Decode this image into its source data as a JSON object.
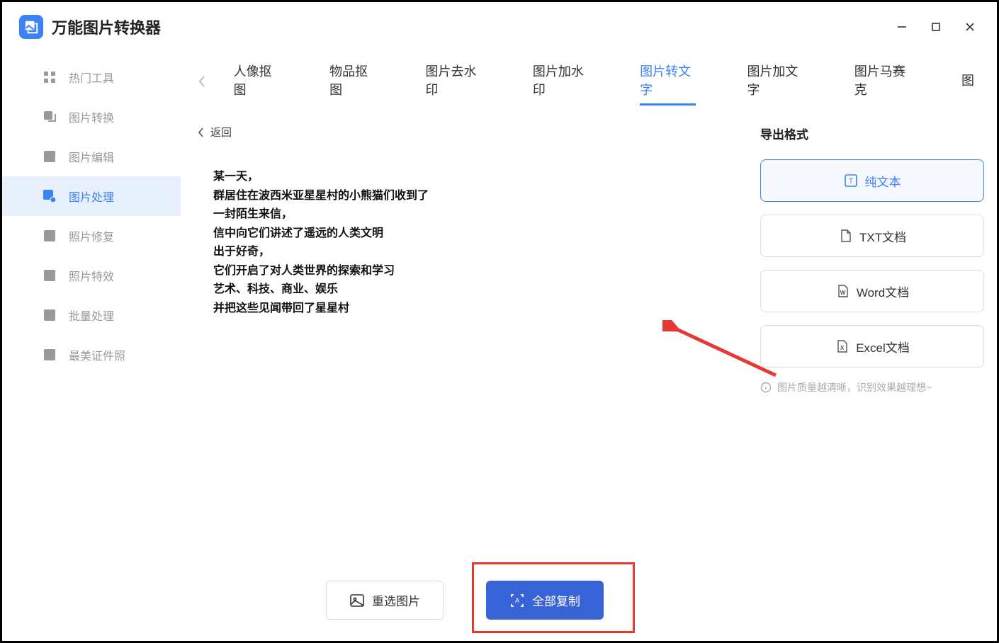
{
  "app": {
    "title": "万能图片转换器"
  },
  "sidebar": {
    "items": [
      {
        "label": "热门工具"
      },
      {
        "label": "图片转换"
      },
      {
        "label": "图片编辑"
      },
      {
        "label": "图片处理"
      },
      {
        "label": "照片修复"
      },
      {
        "label": "照片特效"
      },
      {
        "label": "批量处理"
      },
      {
        "label": "最美证件照"
      }
    ]
  },
  "tabs": {
    "items": [
      {
        "label": "人像抠图"
      },
      {
        "label": "物品抠图"
      },
      {
        "label": "图片去水印"
      },
      {
        "label": "图片加水印"
      },
      {
        "label": "图片转文字"
      },
      {
        "label": "图片加文字"
      },
      {
        "label": "图片马赛克"
      }
    ],
    "clip_label": "图"
  },
  "breadcrumb": {
    "back_label": "返回"
  },
  "ocr_result": {
    "lines": [
      "某一天，",
      "群居住在波西米亚星星村的小熊猫们收到了",
      "一封陌生来信，",
      "信中向它们讲述了遥远的人类文明",
      "出于好奇，",
      "它们开启了对人类世界的探索和学习",
      "艺术、科技、商业、娱乐",
      "并把这些见闻带回了星星村"
    ]
  },
  "actions": {
    "reselect_label": "重选图片",
    "copy_all_label": "全部复制"
  },
  "export": {
    "title": "导出格式",
    "options": [
      {
        "label": "纯文本"
      },
      {
        "label": "TXT文档"
      },
      {
        "label": "Word文档"
      },
      {
        "label": "Excel文档"
      }
    ],
    "hint": "图片质量越清晰，识别效果越理想~"
  }
}
